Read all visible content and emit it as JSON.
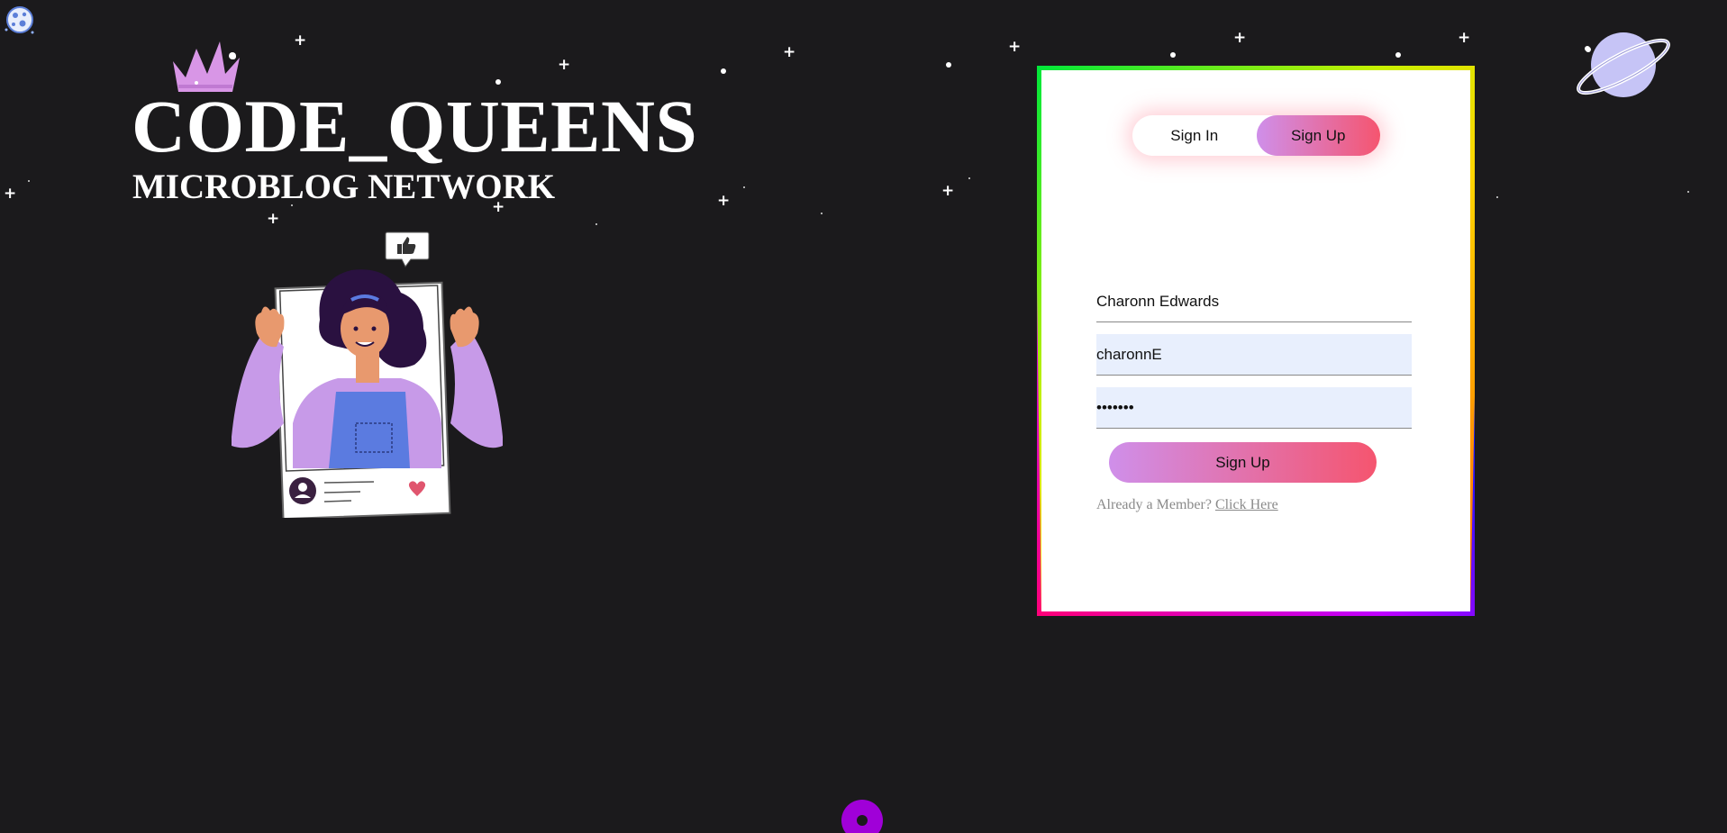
{
  "brand": {
    "title": "CODE_QUEENS",
    "subtitle": "MICROBLOG NETWORK"
  },
  "icons": {
    "crown": "crown-icon",
    "moon": "moon-icon",
    "planet": "planet-icon",
    "like": "thumbs-up-icon",
    "heart": "heart-icon"
  },
  "colors": {
    "background": "#1b1a1c",
    "accent_start": "#cf8fea",
    "accent_end": "#f5556f",
    "input_fill": "#e8effd",
    "donut": "#a000d8"
  },
  "auth": {
    "tabs": [
      {
        "label": "Sign In",
        "active": false
      },
      {
        "label": "Sign Up",
        "active": true
      }
    ],
    "fields": {
      "name": {
        "value": "Charonn Edwards"
      },
      "username": {
        "value": "charonnE"
      },
      "password": {
        "value": "•••••••"
      }
    },
    "submit_label": "Sign Up",
    "member_prompt": "Already a Member?",
    "member_link": "Click Here"
  }
}
